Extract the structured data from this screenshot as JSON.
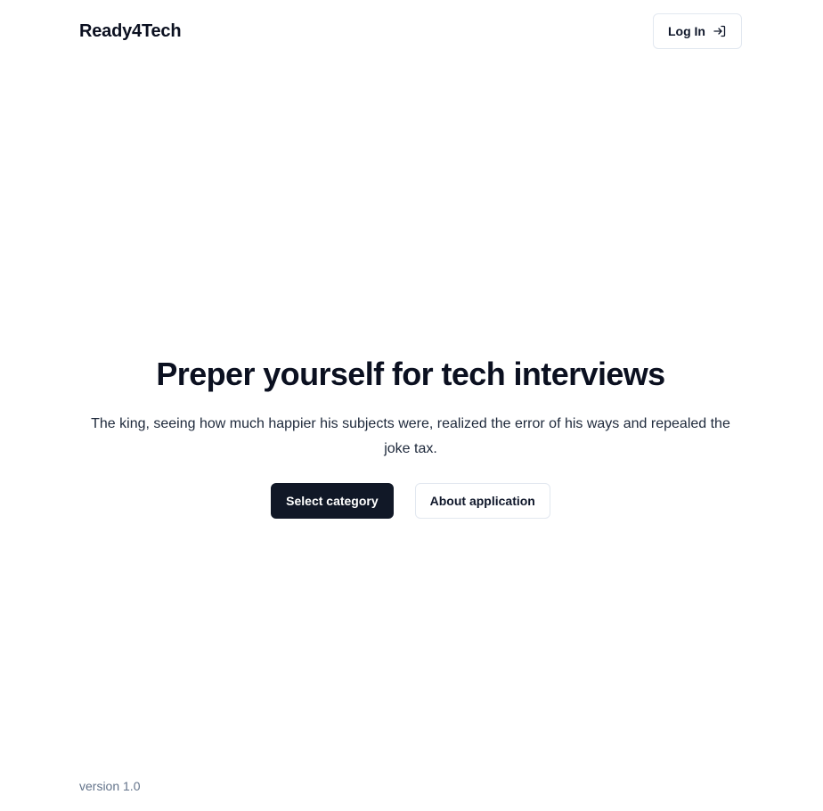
{
  "header": {
    "brand": "Ready4Tech",
    "login_label": "Log In",
    "login_icon": "log-in-icon"
  },
  "hero": {
    "title": "Preper yourself for tech interviews",
    "subtitle": "The king, seeing how much happier his subjects were, realized the error of his ways and repealed the joke tax.",
    "primary_label": "Select category",
    "secondary_label": "About application"
  },
  "footer": {
    "version": "version 1.0"
  },
  "colors": {
    "primary": "#111827",
    "border": "#e2e8f0",
    "text": "#0f172a",
    "muted": "#64748b"
  }
}
